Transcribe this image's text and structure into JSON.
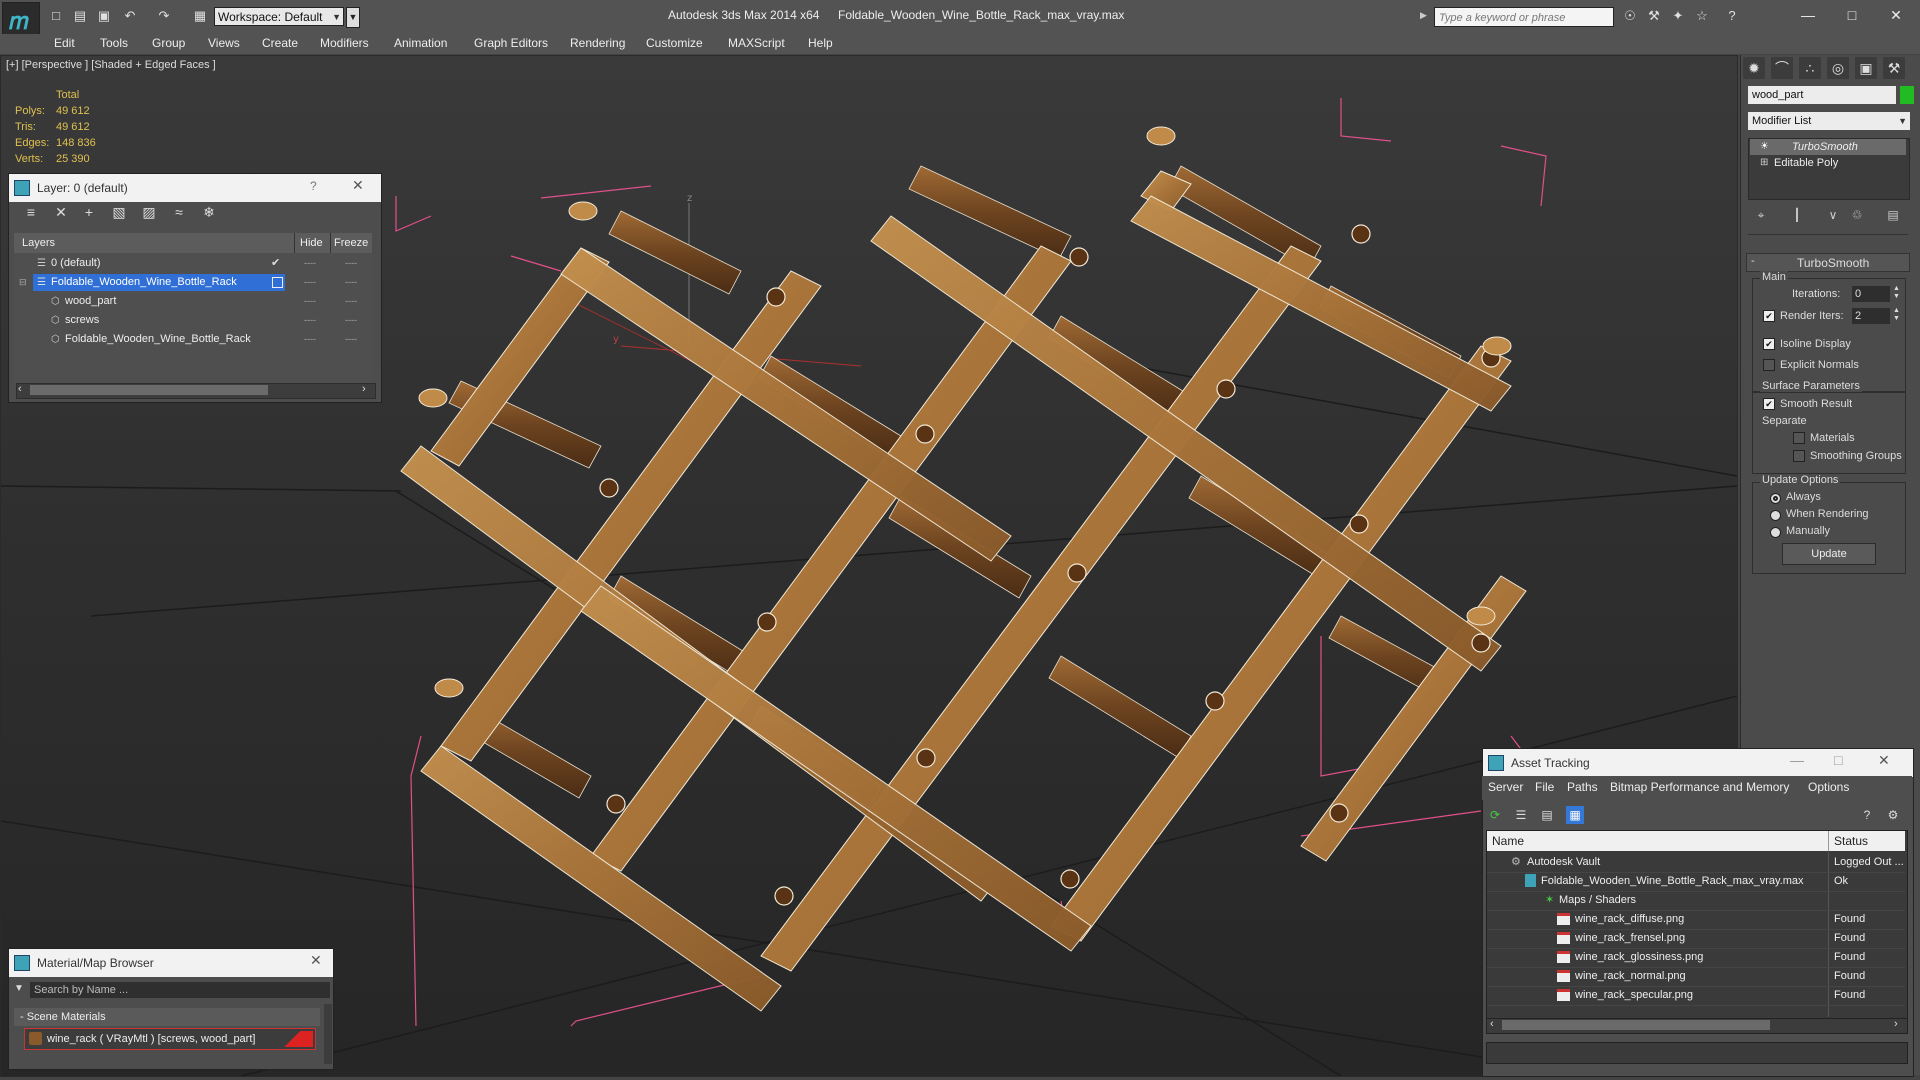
{
  "titlebar": {
    "workspace": "Workspace: Default",
    "app_title": "Autodesk 3ds Max  2014 x64",
    "file_title": "Foldable_Wooden_Wine_Bottle_Rack_max_vray.max",
    "search_placeholder": "Type a keyword or phrase"
  },
  "menus": [
    "Edit",
    "Tools",
    "Group",
    "Views",
    "Create",
    "Modifiers",
    "Animation",
    "Graph Editors",
    "Rendering",
    "Customize",
    "MAXScript",
    "Help"
  ],
  "viewport": {
    "label": "[+] [Perspective ] [Shaded + Edged Faces ]",
    "stats_header": "Total",
    "stats": [
      {
        "label": "Polys:",
        "value": "49 612"
      },
      {
        "label": "Tris:",
        "value": "49 612"
      },
      {
        "label": "Edges:",
        "value": "148 836"
      },
      {
        "label": "Verts:",
        "value": "25 390"
      }
    ]
  },
  "layer_panel": {
    "title": "Layer: 0 (default)",
    "help": "?",
    "col_layers": "Layers",
    "col_hide": "Hide",
    "col_freeze": "Freeze",
    "rows": [
      {
        "name": "0 (default)",
        "indent": 0,
        "selected": false,
        "dash1": "----",
        "dash2": "----"
      },
      {
        "name": "Foldable_Wooden_Wine_Bottle_Rack",
        "indent": 0,
        "selected": true,
        "dash1": "----",
        "dash2": "----"
      },
      {
        "name": "wood_part",
        "indent": 1,
        "selected": false,
        "dash1": "----",
        "dash2": "----"
      },
      {
        "name": "screws",
        "indent": 1,
        "selected": false,
        "dash1": "----",
        "dash2": "----"
      },
      {
        "name": "Foldable_Wooden_Wine_Bottle_Rack",
        "indent": 1,
        "selected": false,
        "dash1": "----",
        "dash2": "----"
      }
    ]
  },
  "material_browser": {
    "title": "Material/Map Browser",
    "search_placeholder": "Search by Name ...",
    "section": "- Scene Materials",
    "item": "wine_rack  ( VRayMtl )  [screws, wood_part]"
  },
  "command_panel": {
    "object_name": "wood_part",
    "modifier_list": "Modifier List",
    "stack": [
      "TurboSmooth",
      "Editable Poly"
    ],
    "rollout_title": "TurboSmooth",
    "main_label": "Main",
    "iterations_label": "Iterations:",
    "iterations_value": "0",
    "render_iters_label": "Render Iters:",
    "render_iters_value": "2",
    "isoline_label": "Isoline Display",
    "explicit_normals_label": "Explicit Normals",
    "surface_params_label": "Surface Parameters",
    "smooth_result_label": "Smooth Result",
    "separate_label": "Separate",
    "materials_label": "Materials",
    "smoothing_groups_label": "Smoothing Groups",
    "update_options_label": "Update Options",
    "always_label": "Always",
    "when_rendering_label": "When Rendering",
    "manually_label": "Manually",
    "update_button": "Update"
  },
  "asset_tracking": {
    "title": "Asset Tracking",
    "menus": [
      "Server",
      "File",
      "Paths",
      "Bitmap Performance and Memory",
      "Options"
    ],
    "col_name": "Name",
    "col_status": "Status",
    "rows": [
      {
        "name": "Autodesk Vault",
        "status": "Logged Out ...",
        "indent": 1,
        "icon": "vault"
      },
      {
        "name": "Foldable_Wooden_Wine_Bottle_Rack_max_vray.max",
        "status": "Ok",
        "indent": 2,
        "icon": "max"
      },
      {
        "name": "Maps / Shaders",
        "status": "",
        "indent": 3,
        "icon": "maps"
      },
      {
        "name": "wine_rack_diffuse.png",
        "status": "Found",
        "indent": 4,
        "icon": "png"
      },
      {
        "name": "wine_rack_frensel.png",
        "status": "Found",
        "indent": 4,
        "icon": "png"
      },
      {
        "name": "wine_rack_glossiness.png",
        "status": "Found",
        "indent": 4,
        "icon": "png"
      },
      {
        "name": "wine_rack_normal.png",
        "status": "Found",
        "indent": 4,
        "icon": "png"
      },
      {
        "name": "wine_rack_specular.png",
        "status": "Found",
        "indent": 4,
        "icon": "png"
      }
    ]
  },
  "colors": {
    "wood": "#b07a3c",
    "wood_dark": "#7a4e22",
    "bbox": "#e0508a",
    "selection": "#2f6fd6",
    "stat_yellow": "#e0c050"
  }
}
